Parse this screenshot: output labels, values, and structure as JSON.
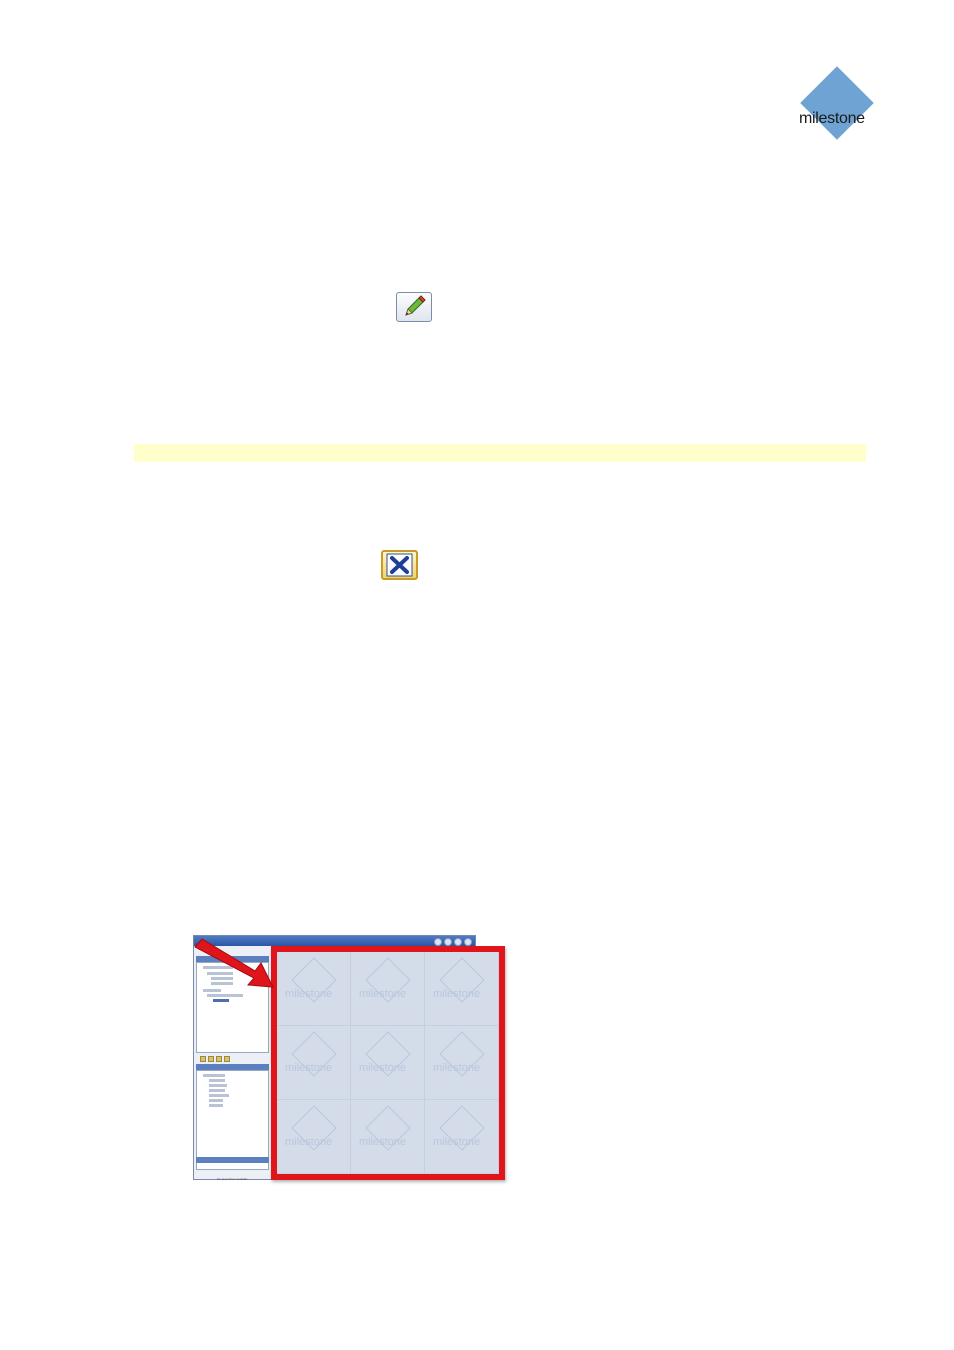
{
  "logo": {
    "text": "milestone",
    "color": "#6ea3d3"
  },
  "icons": {
    "edit": "edit-pencil-icon",
    "delete": "delete-x-icon"
  },
  "highlight_color": "#ffffcc",
  "screenshot": {
    "watermark_text": "milestone",
    "properties_text": "No properties available",
    "frame_color": "#e0141b",
    "arrow_color": "#e0141b"
  }
}
